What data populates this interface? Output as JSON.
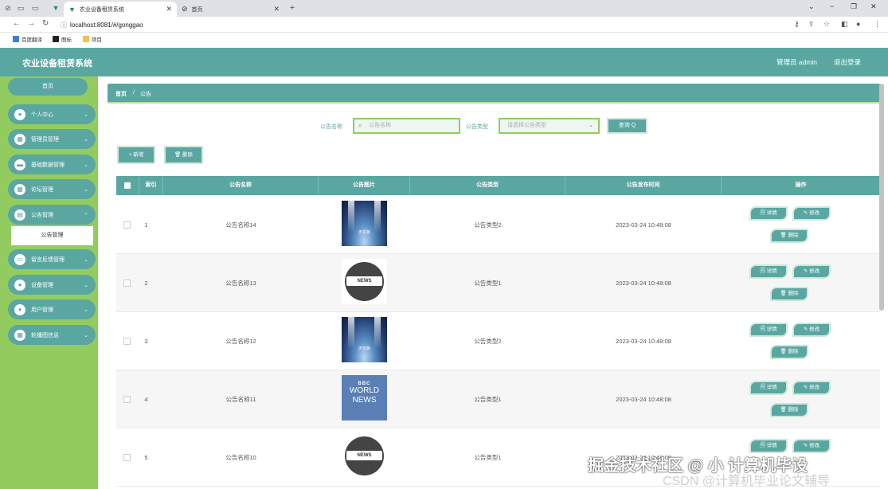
{
  "browser": {
    "tabs": [
      {
        "title": "农业设备租赁系统"
      },
      {
        "title": "首页"
      }
    ],
    "url": "localhost:8081/#/gonggao",
    "bookmarks": [
      "百度翻译",
      "图标",
      "项目"
    ]
  },
  "header": {
    "title": "农业设备租赁系统",
    "user": "管理员 admin",
    "logout": "退出登录"
  },
  "sidebar": {
    "home": "首页",
    "items": [
      {
        "label": "个人中心"
      },
      {
        "label": "管理员管理"
      },
      {
        "label": "基础数据管理"
      },
      {
        "label": "论坛管理"
      },
      {
        "label": "公告管理"
      },
      {
        "label": "留言反馈管理"
      },
      {
        "label": "设备管理"
      },
      {
        "label": "用户管理"
      },
      {
        "label": "轮播图信息"
      }
    ],
    "sub_active": "公告管理"
  },
  "breadcrumb": {
    "home": "首页",
    "sep": "/",
    "current": "公告"
  },
  "search": {
    "name_label": "公告名称",
    "name_placeholder": "公告名称",
    "type_label": "公告类型",
    "type_placeholder": "请选择公告类型",
    "query_button": "查询 Q"
  },
  "actions": {
    "add": "+ 新增",
    "delete": "🗑 删除"
  },
  "table": {
    "headers": [
      "索引",
      "公告名称",
      "公告图片",
      "公告类型",
      "公告发布时间",
      "操作"
    ],
    "rows": [
      {
        "index": "1",
        "name": "公告名称14",
        "image": "stage",
        "type": "公告类型2",
        "time": "2023-03-24 10:48:08"
      },
      {
        "index": "2",
        "name": "公告名称13",
        "image": "globe",
        "type": "公告类型1",
        "time": "2023-03-24 10:48:08"
      },
      {
        "index": "3",
        "name": "公告名称12",
        "image": "stage",
        "type": "公告类型2",
        "time": "2023-03-24 10:48:08"
      },
      {
        "index": "4",
        "name": "公告名称11",
        "image": "bbc",
        "type": "公告类型1",
        "time": "2023-03-24 10:48:08"
      },
      {
        "index": "5",
        "name": "公告名称10",
        "image": "globe",
        "type": "公告类型1",
        "time": "2023-03-24 10:48:08"
      }
    ],
    "op_detail": "详情",
    "op_edit": "修改",
    "op_delete": "删除",
    "img_text": {
      "stage": "天花板",
      "globe": "NEWS",
      "bbc_1": "BBC",
      "bbc_2": "WORLD",
      "bbc_3": "NEWS"
    }
  },
  "watermark": {
    "line1": "掘金技术社区 @ 小 计算机毕设",
    "line2": "CSDN @计算机毕业论文辅导"
  },
  "colors": {
    "primary": "#5aa7a2",
    "sidebar": "#92cc5f",
    "accent_border": "#cfe8d7"
  }
}
